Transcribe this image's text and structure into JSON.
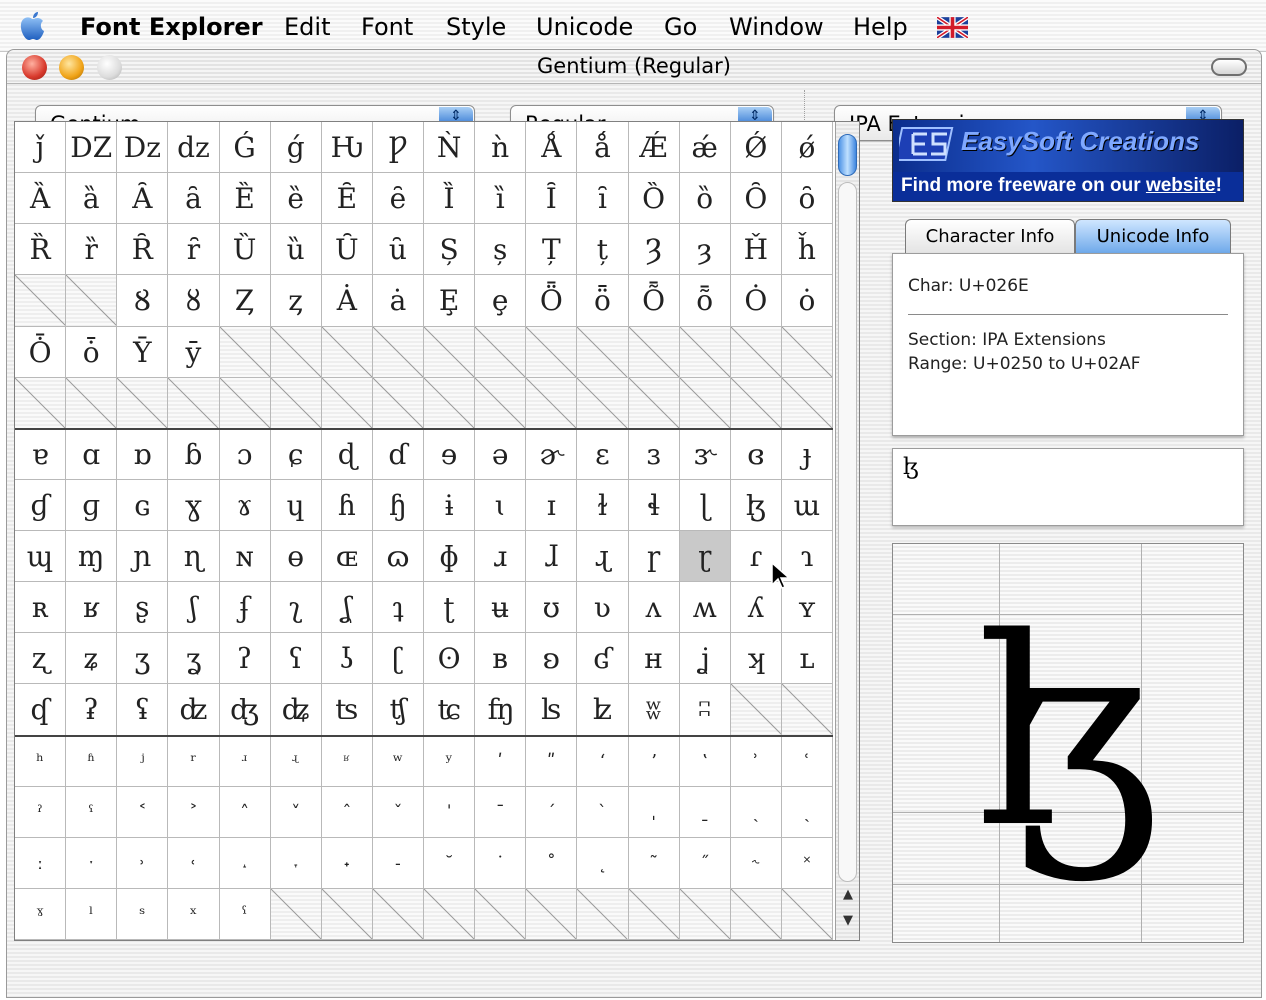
{
  "menubar": {
    "apple_icon": "apple-icon",
    "app_name": "Font Explorer",
    "items": [
      "Edit",
      "Font",
      "Style",
      "Unicode",
      "Go",
      "Window",
      "Help"
    ],
    "flag_icon": "uk-flag-icon"
  },
  "window": {
    "title": "Gentium (Regular)"
  },
  "toolbar": {
    "font_family": "Gentium",
    "font_style": "Regular",
    "unicode_range": "IPA Extensions",
    "popup_arrows": "⇕"
  },
  "grid": {
    "columns": 16,
    "selected": {
      "row": 8,
      "col": 13
    },
    "rows": [
      [
        "ǰ",
        "Ǳ",
        "ǲ",
        "ǳ",
        "Ǵ",
        "ǵ",
        "Ƕ",
        "Ƿ",
        "Ǹ",
        "ǹ",
        "Ǻ",
        "ǻ",
        "Ǽ",
        "ǽ",
        "Ǿ",
        "ǿ"
      ],
      [
        "Ȁ",
        "ȁ",
        "Ȃ",
        "ȃ",
        "Ȅ",
        "ȅ",
        "Ȇ",
        "ȇ",
        "Ȉ",
        "ȉ",
        "Ȋ",
        "ȋ",
        "Ȍ",
        "ȍ",
        "Ȏ",
        "ȏ"
      ],
      [
        "Ȑ",
        "ȑ",
        "Ȓ",
        "ȓ",
        "Ȕ",
        "ȕ",
        "Ȗ",
        "ȗ",
        "Ș",
        "ș",
        "Ț",
        "ț",
        "Ȝ",
        "ȝ",
        "Ȟ",
        "ȟ"
      ],
      [
        "",
        "",
        "Ȣ",
        "ȣ",
        "Ȥ",
        "ȥ",
        "Ȧ",
        "ȧ",
        "Ȩ",
        "ȩ",
        "Ȫ",
        "ȫ",
        "Ȭ",
        "ȭ",
        "Ȯ",
        "ȯ"
      ],
      [
        "Ȱ",
        "ȱ",
        "Ȳ",
        "ȳ",
        "",
        "",
        "",
        "",
        "",
        "",
        "",
        "",
        "",
        "",
        "",
        ""
      ],
      [
        "",
        "",
        "",
        "",
        "",
        "",
        "",
        "",
        "",
        "",
        "",
        "",
        "",
        "",
        "",
        ""
      ],
      [
        "ɐ",
        "ɑ",
        "ɒ",
        "ɓ",
        "ɔ",
        "ɕ",
        "ɖ",
        "ɗ",
        "ɘ",
        "ə",
        "ɚ",
        "ɛ",
        "ɜ",
        "ɝ",
        "ɞ",
        "ɟ"
      ],
      [
        "ɠ",
        "ɡ",
        "ɢ",
        "ɣ",
        "ɤ",
        "ɥ",
        "ɦ",
        "ɧ",
        "ɨ",
        "ɩ",
        "ɪ",
        "ɫ",
        "ɬ",
        "ɭ",
        "ɮ",
        "ɯ"
      ],
      [
        "ɰ",
        "ɱ",
        "ɲ",
        "ɳ",
        "ɴ",
        "ɵ",
        "ɶ",
        "ɷ",
        "ɸ",
        "ɹ",
        "ɺ",
        "ɻ",
        "ɼ",
        "ɽ",
        "ɾ",
        "ɿ"
      ],
      [
        "ʀ",
        "ʁ",
        "ʂ",
        "ʃ",
        "ʄ",
        "ʅ",
        "ʆ",
        "ʇ",
        "ʈ",
        "ʉ",
        "ʊ",
        "ʋ",
        "ʌ",
        "ʍ",
        "ʎ",
        "ʏ"
      ],
      [
        "ʐ",
        "ʑ",
        "ʒ",
        "ʓ",
        "ʔ",
        "ʕ",
        "ʖ",
        "ʗ",
        "ʘ",
        "ʙ",
        "ʚ",
        "ʛ",
        "ʜ",
        "ʝ",
        "ʞ",
        "ʟ"
      ],
      [
        "ʠ",
        "ʡ",
        "ʢ",
        "ʣ",
        "ʤ",
        "ʥ",
        "ʦ",
        "ʧ",
        "ʨ",
        "ʩ",
        "ʪ",
        "ʫ",
        "ʬ",
        "ʭ",
        "",
        ""
      ],
      [
        "ʰ",
        "ʱ",
        "ʲ",
        "ʳ",
        "ʴ",
        "ʵ",
        "ʶ",
        "ʷ",
        "ʸ",
        "ʹ",
        "ʺ",
        "ʻ",
        "ʼ",
        "ʽ",
        "ʾ",
        "ʿ"
      ],
      [
        "ˀ",
        "ˁ",
        "˂",
        "˃",
        "˄",
        "˅",
        "ˆ",
        "ˇ",
        "ˈ",
        "ˉ",
        "ˊ",
        "ˋ",
        "ˌ",
        "ˍ",
        "ˎ",
        "ˏ"
      ],
      [
        "ː",
        "ˑ",
        "˒",
        "˓",
        "˔",
        "˕",
        "˖",
        "˗",
        "˘",
        "˙",
        "˚",
        "˛",
        "˜",
        "˝",
        "˞",
        "˟"
      ],
      [
        "ˠ",
        "ˡ",
        "ˢ",
        "ˣ",
        "ˤ",
        "",
        "",
        "",
        "",
        "",
        "",
        "",
        "",
        "",
        "",
        ""
      ]
    ]
  },
  "banner": {
    "title": "EasySoft Creations",
    "subtitle_prefix": "Find more freeware on our ",
    "subtitle_link": "website",
    "subtitle_suffix": "!"
  },
  "tabs": {
    "character_info": "Character Info",
    "unicode_info": "Unicode Info"
  },
  "info": {
    "char": "Char: U+026E",
    "section": "Section: IPA Extensions",
    "range": "Range: U+0250 to U+02AF"
  },
  "char_field": {
    "value": "ɮ"
  },
  "preview": {
    "glyph": "ɮ"
  },
  "scrollbar": {
    "up_arrow": "▲",
    "down_arrow": "▼"
  }
}
